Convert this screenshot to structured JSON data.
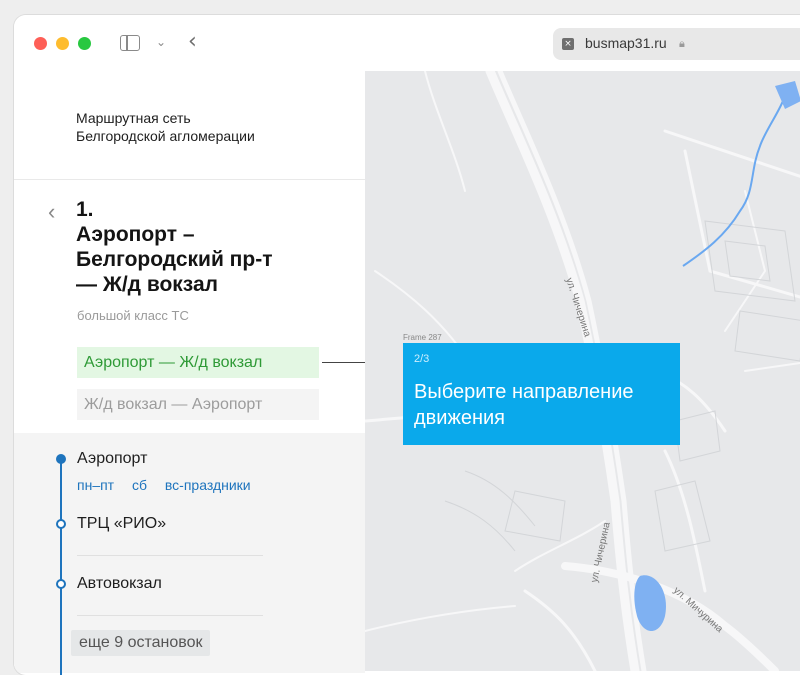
{
  "browser": {
    "url": "busmap31.ru",
    "controls": {
      "sidebar_icon": "sidebar-icon",
      "chevron_icon": "chevron-down-icon",
      "back_icon": "chevron-left-icon"
    }
  },
  "site": {
    "title_line1": "Маршрутная сеть",
    "title_line2": "Белгородской агломерации"
  },
  "route": {
    "number": "1.",
    "name_line1": "Аэропорт –",
    "name_line2": "Белгородский пр-т",
    "name_line3": "— Ж/д вокзал",
    "vehicle_class": "большой класс ТС",
    "directions": [
      {
        "label": "Аэропорт — Ж/д вокзал",
        "active": true
      },
      {
        "label": "Ж/д вокзал — Аэропорт",
        "active": false
      }
    ]
  },
  "stops": [
    {
      "name": "Аэропорт",
      "schedule": [
        "пн–пт",
        "сб",
        "вс-праздники"
      ]
    },
    {
      "name": "ТРЦ «РИО»"
    },
    {
      "name": "Автовокзал"
    }
  ],
  "more_stops": "еще 9 остановок",
  "map": {
    "streets": [
      "ул. Чичерина",
      "ул. Чичерина",
      "ул. Мичурина"
    ],
    "frame_label": "Frame 287"
  },
  "tooltip": {
    "step": "2/3",
    "text": "Выберите направление движения"
  },
  "colors": {
    "accent_blue": "#1e74bd",
    "tooltip_bg": "#0aa9eb",
    "active_direction": "#2e9a36",
    "active_direction_bg": "#e3f7e3"
  }
}
